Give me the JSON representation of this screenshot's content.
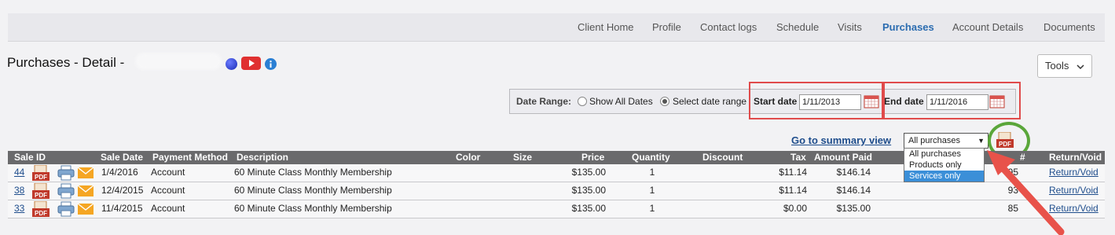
{
  "nav": {
    "items": [
      {
        "label": "Client Home"
      },
      {
        "label": "Profile"
      },
      {
        "label": "Contact logs"
      },
      {
        "label": "Schedule"
      },
      {
        "label": "Visits"
      },
      {
        "label": "Purchases",
        "active": true
      },
      {
        "label": "Account Details"
      },
      {
        "label": "Documents"
      }
    ]
  },
  "page": {
    "title": "Purchases - Detail -"
  },
  "tools": {
    "label": "Tools"
  },
  "date_range": {
    "label": "Date Range:",
    "option_all": "Show All Dates",
    "option_select": "Select date range",
    "selected": "select",
    "start_label": "Start date",
    "start_value": "1/11/2013",
    "end_label": "End date",
    "end_value": "1/11/2016"
  },
  "summary_link": "Go to summary view",
  "filter": {
    "selected": "All purchases",
    "options": [
      "All purchases",
      "Products only",
      "Services only"
    ],
    "highlighted": "Services only"
  },
  "table": {
    "columns": [
      "Sale ID",
      "Sale Date",
      "Payment Method",
      "Description",
      "Color",
      "Size",
      "Price",
      "Quantity",
      "Discount",
      "Tax",
      "Amount Paid",
      "#",
      "Return/Void"
    ],
    "rows": [
      {
        "sale_id": "44",
        "sale_date": "1/4/2016",
        "payment": "Account",
        "description": "60 Minute Class Monthly Membership",
        "price": "$135.00",
        "quantity": "1",
        "tax": "$11.14",
        "amount_paid": "$146.14",
        "num": "95",
        "action": "Return/Void"
      },
      {
        "sale_id": "38",
        "sale_date": "12/4/2015",
        "payment": "Account",
        "description": "60 Minute Class Monthly Membership",
        "price": "$135.00",
        "quantity": "1",
        "tax": "$11.14",
        "amount_paid": "$146.14",
        "num": "93",
        "action": "Return/Void"
      },
      {
        "sale_id": "33",
        "sale_date": "11/4/2015",
        "payment": "Account",
        "description": "60 Minute Class Monthly Membership",
        "price": "$135.00",
        "quantity": "1",
        "tax": "$0.00",
        "amount_paid": "$135.00",
        "num": "85",
        "action": "Return/Void"
      }
    ]
  },
  "colors": {
    "accent": "#2b6cb0",
    "annotation_red": "#e04b4b",
    "annotation_green": "#5aa63a",
    "header_bg": "#6a6a6c"
  },
  "icons": [
    "globe-icon",
    "youtube-icon",
    "info-icon",
    "calendar-icon",
    "pdf-icon",
    "print-icon",
    "email-icon"
  ]
}
